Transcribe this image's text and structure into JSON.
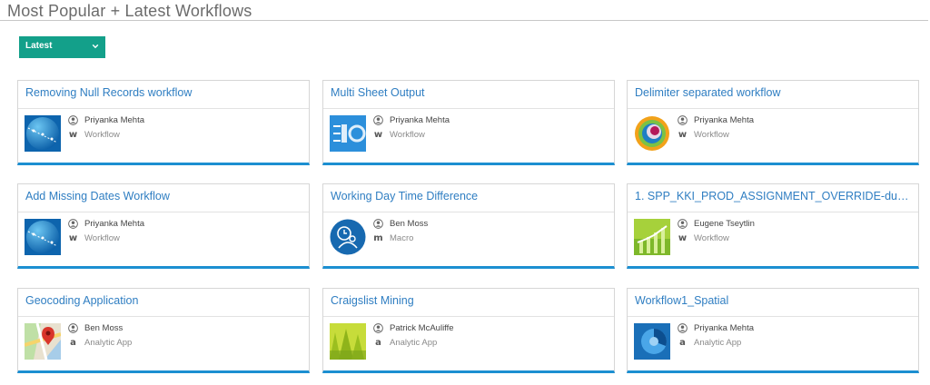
{
  "page": {
    "title": "Most Popular + Latest Workflows"
  },
  "filter": {
    "selected": "Latest"
  },
  "cards": [
    {
      "title": "Removing Null Records workflow",
      "author": "Priyanka Mehta",
      "type": "Workflow",
      "type_glyph": "w",
      "thumb": "globe-workflow-icon"
    },
    {
      "title": "Multi Sheet Output",
      "author": "Priyanka Mehta",
      "type": "Workflow",
      "type_glyph": "w",
      "thumb": "sheet-output-icon"
    },
    {
      "title": "Delimiter separated workflow",
      "author": "Priyanka Mehta",
      "type": "Workflow",
      "type_glyph": "w",
      "thumb": "target-icon"
    },
    {
      "title": "Add Missing Dates Workflow",
      "author": "Priyanka Mehta",
      "type": "Workflow",
      "type_glyph": "w",
      "thumb": "globe-workflow-icon"
    },
    {
      "title": "Working Day Time Difference",
      "author": "Ben Moss",
      "type": "Macro",
      "type_glyph": "m",
      "thumb": "clock-person-icon"
    },
    {
      "title": "1. SPP_KKI_PROD_ASSIGNMENT_OVERRIDE-dups i...",
      "author": "Eugene Tseytlin",
      "type": "Workflow",
      "type_glyph": "w",
      "thumb": "growth-chart-icon"
    },
    {
      "title": "Geocoding Application",
      "author": "Ben Moss",
      "type": "Analytic App",
      "type_glyph": "a",
      "thumb": "map-pin-icon"
    },
    {
      "title": "Craigslist Mining",
      "author": "Patrick McAuliffe",
      "type": "Analytic App",
      "type_glyph": "a",
      "thumb": "green-app-icon"
    },
    {
      "title": "Workflow1_Spatial",
      "author": "Priyanka Mehta",
      "type": "Analytic App",
      "type_glyph": "a",
      "thumb": "pie-icon"
    }
  ],
  "colors": {
    "accent": "#1c8fd1",
    "filter_bg": "#13a08a",
    "link": "#2f7ec2"
  }
}
